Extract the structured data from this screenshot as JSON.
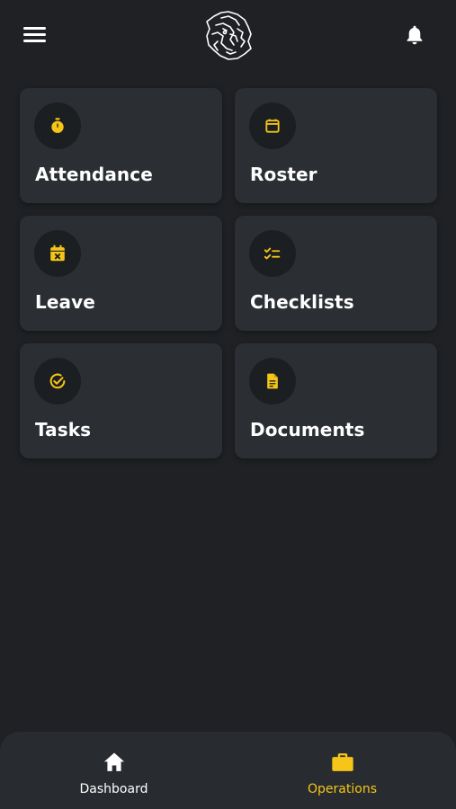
{
  "colors": {
    "accent": "#f5c518",
    "background": "#1f2124",
    "card": "#2b2f33",
    "icon_circle": "#1c1f22"
  },
  "header": {
    "menu_icon": "hamburger-icon",
    "logo": "lion-logo",
    "notification_icon": "bell-icon"
  },
  "tiles": [
    {
      "label": "Attendance",
      "icon": "stopwatch-icon"
    },
    {
      "label": "Roster",
      "icon": "calendar-icon"
    },
    {
      "label": "Leave",
      "icon": "calendar-x-icon"
    },
    {
      "label": "Checklists",
      "icon": "checklist-icon"
    },
    {
      "label": "Tasks",
      "icon": "check-circle-icon"
    },
    {
      "label": "Documents",
      "icon": "document-icon"
    }
  ],
  "bottom_nav": {
    "items": [
      {
        "label": "Dashboard",
        "icon": "home-icon",
        "active": false
      },
      {
        "label": "Operations",
        "icon": "briefcase-icon",
        "active": true
      }
    ]
  }
}
